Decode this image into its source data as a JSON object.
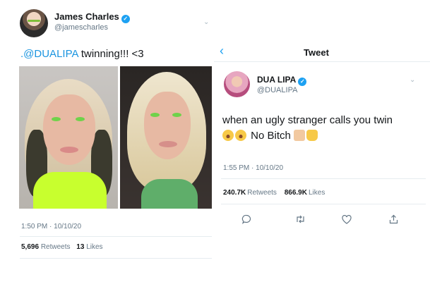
{
  "left_tweet": {
    "author_name": "James Charles",
    "author_handle": "@jamescharles",
    "verified_mark": "✓",
    "chevron": "⌄",
    "text_mention": ".@DUALIPA",
    "text_rest": " twinning!!! <3",
    "timestamp": "1:50 PM · 10/10/20",
    "retweets_count": "5,696",
    "retweets_label": "Retweets",
    "likes_count": "13",
    "likes_label": "Likes"
  },
  "right_tweet": {
    "back_icon": "‹",
    "header_title": "Tweet",
    "author_name": "DUA LIPA",
    "author_handle": "@DUALIPA",
    "verified_mark": "✓",
    "chevron": "⌄",
    "text_line1": "when an ugly stranger calls you twin",
    "text_line2": "No Bitch",
    "timestamp": "1:55 PM · 10/10/20",
    "retweets_count": "240.7K",
    "retweets_label": "Retweets",
    "likes_count": "866.9K",
    "likes_label": "Likes",
    "actions": {
      "reply_icon": "○",
      "retweet_icon": "⇆",
      "like_icon": "♡",
      "share_icon": "⇪"
    }
  },
  "colors": {
    "link_blue": "#1b95e0",
    "verified_blue": "#1da1f2",
    "secondary_text": "#657786",
    "divider": "#e6ecf0"
  }
}
